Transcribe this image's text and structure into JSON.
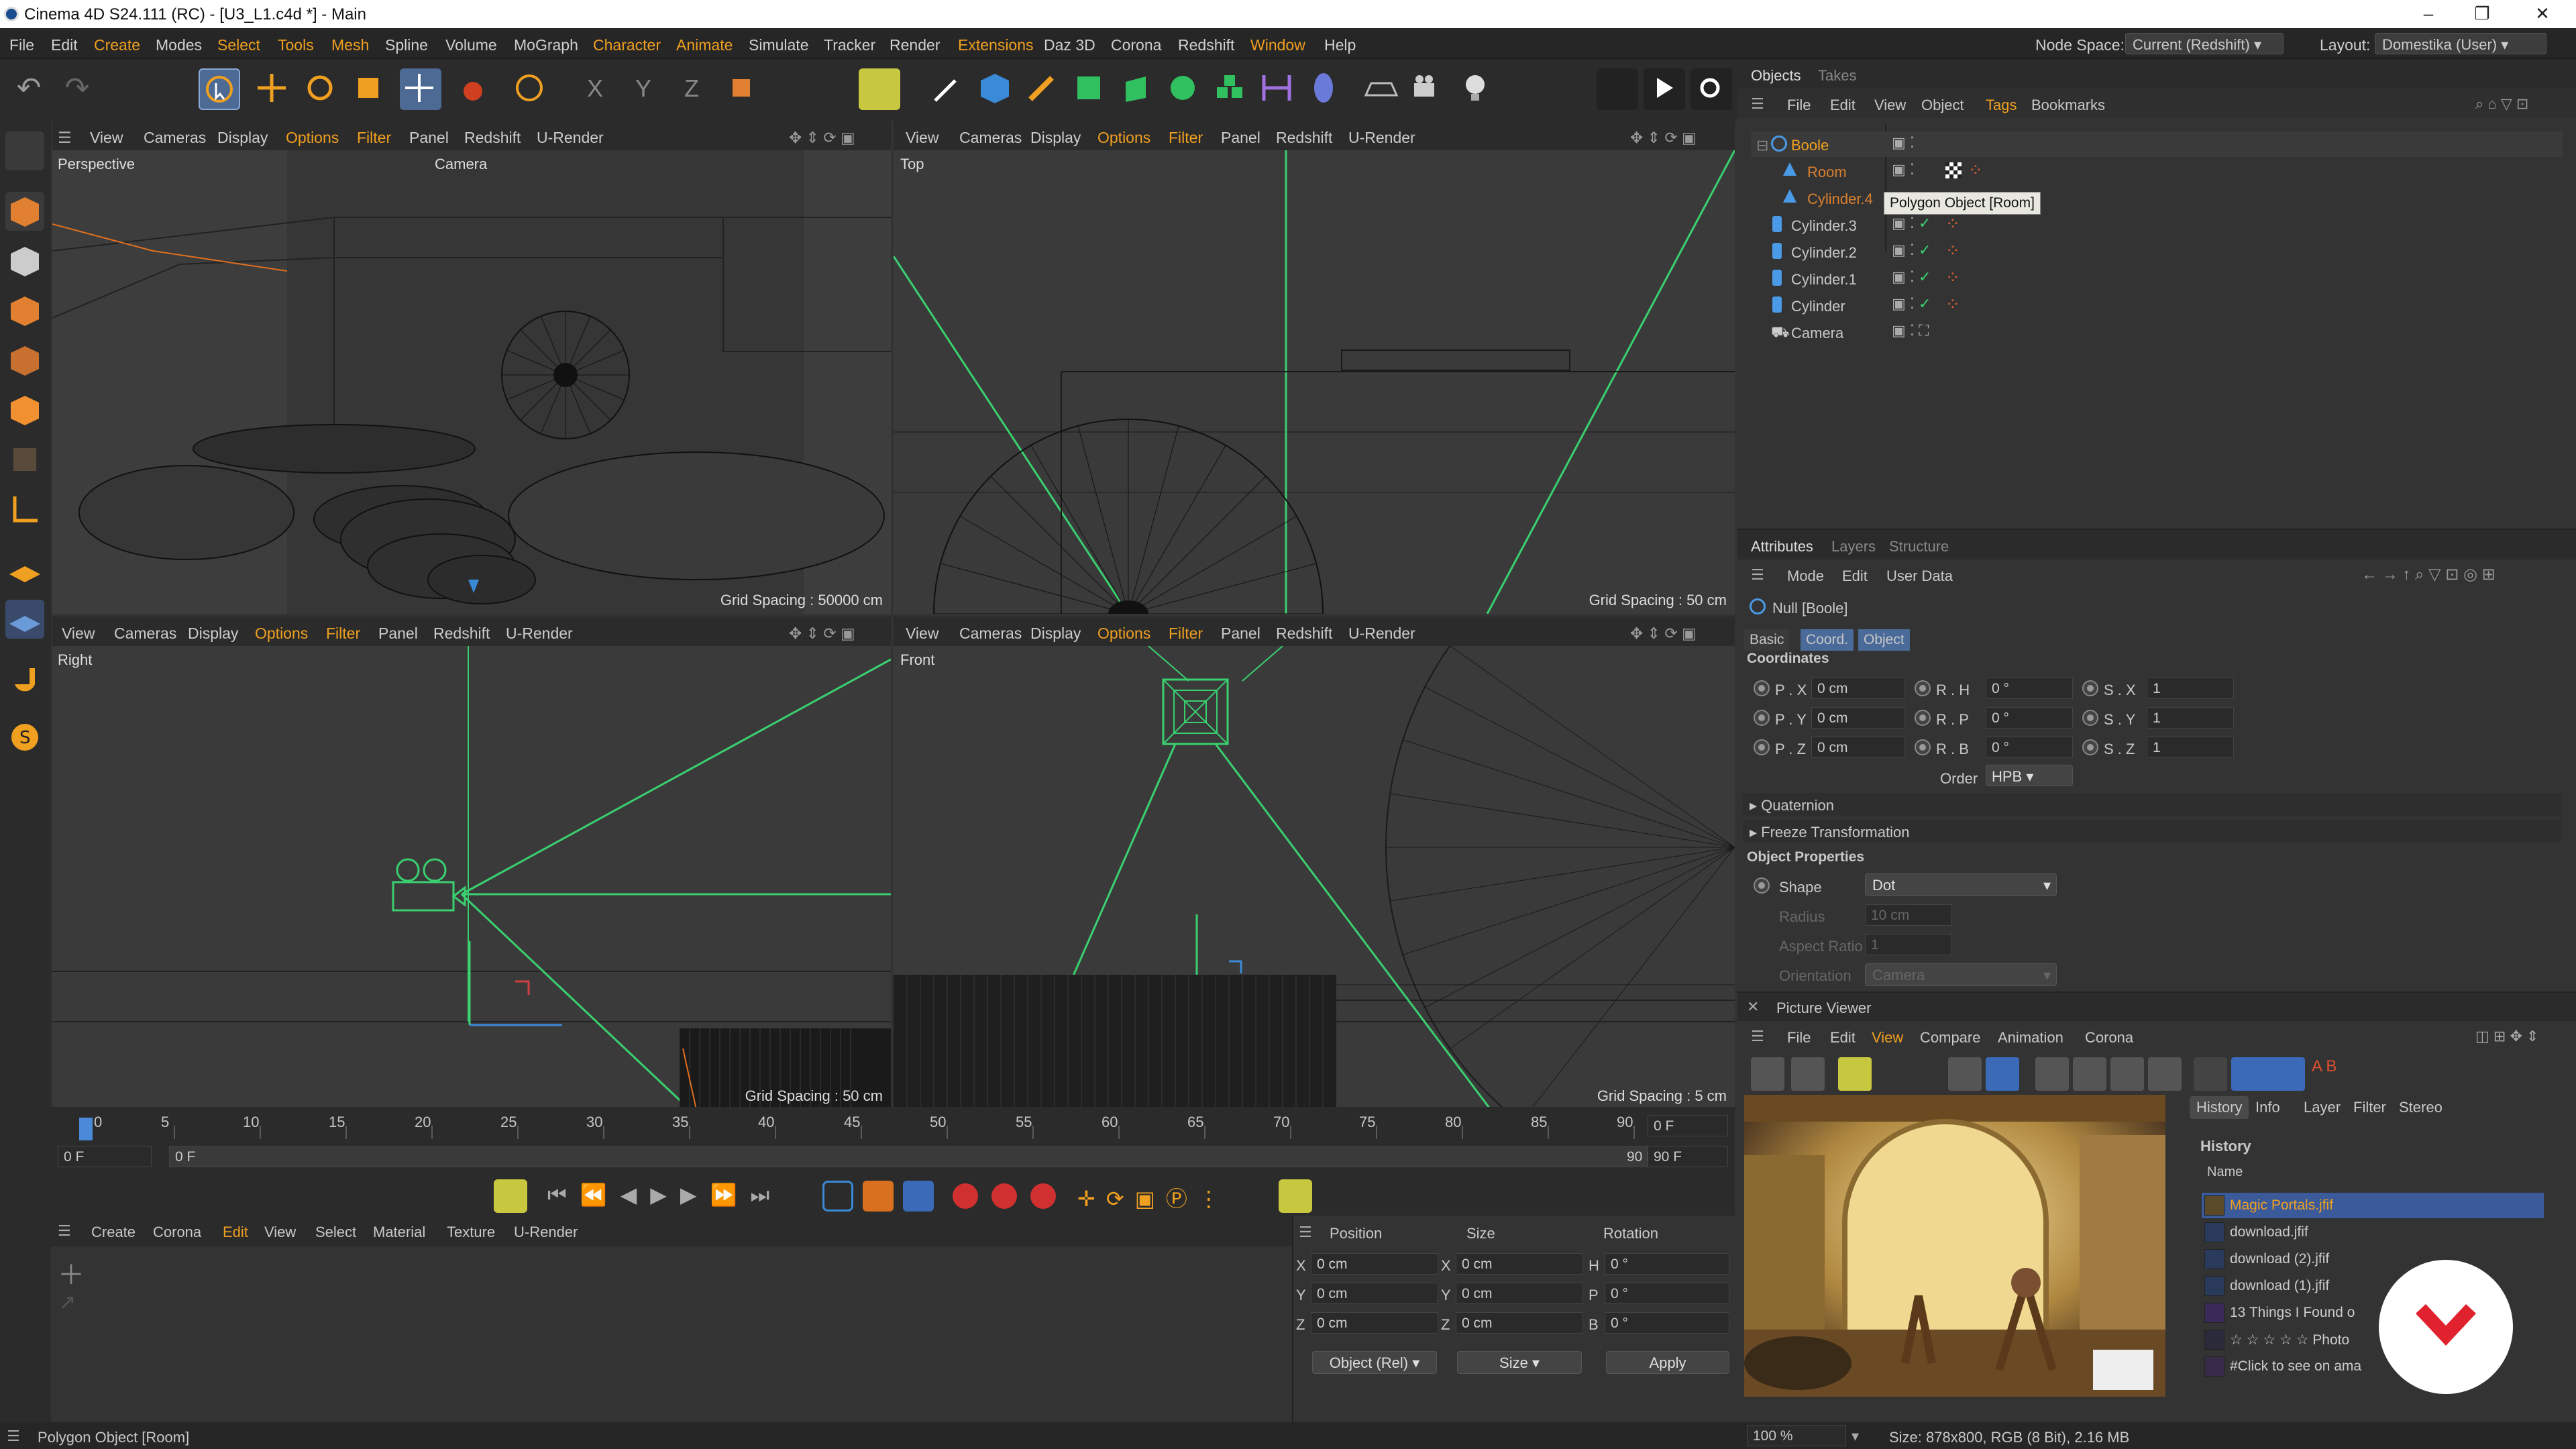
{
  "window": {
    "title": "Cinema 4D S24.111 (RC) - [U3_L1.c4d *] - Main",
    "min": "–",
    "max": "❐",
    "close": "✕"
  },
  "menu": {
    "items": [
      "File",
      "Edit",
      "Create",
      "Modes",
      "Select",
      "Tools",
      "Mesh",
      "Spline",
      "Volume",
      "MoGraph",
      "Character",
      "Animate",
      "Simulate",
      "Tracker",
      "Render",
      "Extensions",
      "Daz 3D",
      "Corona",
      "Redshift",
      "Window",
      "Help"
    ],
    "highlighted": [
      "Create",
      "Select",
      "Tools",
      "Mesh",
      "Character",
      "Animate",
      "Extensions",
      "Window"
    ],
    "node_space_label": "Node Space:",
    "node_space_value": "Current (Redshift)",
    "layout_label": "Layout:",
    "layout_value": "Domestika (User)"
  },
  "viewport_menu": [
    "View",
    "Cameras",
    "Display",
    "Options",
    "Filter",
    "Panel",
    "Redshift",
    "U-Render"
  ],
  "viewports": {
    "perspective": {
      "label": "Perspective",
      "camera": "Camera",
      "grid": "Grid Spacing : 50000 cm"
    },
    "top": {
      "label": "Top",
      "grid": "Grid Spacing : 50 cm"
    },
    "right": {
      "label": "Right",
      "grid": "Grid Spacing : 50 cm"
    },
    "front": {
      "label": "Front",
      "grid": "Grid Spacing : 5 cm"
    }
  },
  "timeline": {
    "ticks": [
      "0",
      "5",
      "10",
      "15",
      "20",
      "25",
      "30",
      "35",
      "40",
      "45",
      "50",
      "55",
      "60",
      "65",
      "70",
      "75",
      "80",
      "85",
      "90"
    ],
    "frame_current": "0 F",
    "start": "0 F",
    "start2": "0 F",
    "end": "90 F",
    "end2": "90 F"
  },
  "material_menu": [
    "Create",
    "Corona",
    "Edit",
    "View",
    "Select",
    "Material",
    "Texture",
    "U-Render"
  ],
  "coords": {
    "headers": [
      "Position",
      "Size",
      "Rotation"
    ],
    "rows": [
      {
        "axis": "X",
        "pos": "0 cm",
        "size_axis": "X",
        "size": "0 cm",
        "rot_axis": "H",
        "rot": "0 °"
      },
      {
        "axis": "Y",
        "pos": "0 cm",
        "size_axis": "Y",
        "size": "0 cm",
        "rot_axis": "P",
        "rot": "0 °"
      },
      {
        "axis": "Z",
        "pos": "0 cm",
        "size_axis": "Z",
        "size": "0 cm",
        "rot_axis": "B",
        "rot": "0 °"
      }
    ],
    "mode": "Object (Rel)",
    "size_mode": "Size",
    "apply": "Apply"
  },
  "status": "Polygon Object [Room]",
  "objects_panel": {
    "tabs": [
      "Objects",
      "Takes"
    ],
    "menu": [
      "File",
      "Edit",
      "View",
      "Object",
      "Tags",
      "Bookmarks"
    ],
    "tree": [
      {
        "name": "Boole",
        "color": "#f0a020"
      },
      {
        "name": "Room",
        "color": "#d88030"
      },
      {
        "name": "Cylinder.4",
        "color": "#d88030"
      },
      {
        "name": "Cylinder.3",
        "color": "#ccc"
      },
      {
        "name": "Cylinder.2",
        "color": "#ccc"
      },
      {
        "name": "Cylinder.1",
        "color": "#ccc"
      },
      {
        "name": "Cylinder",
        "color": "#ccc"
      },
      {
        "name": "Camera",
        "color": "#ccc"
      }
    ],
    "tooltip": "Polygon Object [Room]"
  },
  "attributes": {
    "tabs": [
      "Attributes",
      "Layers",
      "Structure"
    ],
    "menu": [
      "Mode",
      "Edit",
      "User Data"
    ],
    "object": "Null [Boole]",
    "subtabs": [
      "Basic",
      "Coord.",
      "Object"
    ],
    "section": "Coordinates",
    "rows": [
      {
        "p": "P . X",
        "pv": "0 cm",
        "r": "R . H",
        "rv": "0 °",
        "s": "S . X",
        "sv": "1"
      },
      {
        "p": "P . Y",
        "pv": "0 cm",
        "r": "R . P",
        "rv": "0 °",
        "s": "S . Y",
        "sv": "1"
      },
      {
        "p": "P . Z",
        "pv": "0 cm",
        "r": "R . B",
        "rv": "0 °",
        "s": "S . Z",
        "sv": "1"
      }
    ],
    "order_label": "Order",
    "order_value": "HPB",
    "quaternion": "Quaternion",
    "freeze": "Freeze Transformation",
    "obj_props": "Object Properties",
    "shape_label": "Shape",
    "shape_value": "Dot",
    "radius_label": "Radius",
    "radius_value": "10 cm",
    "aspect_label": "Aspect Ratio",
    "aspect_value": "1",
    "orient_label": "Orientation",
    "orient_value": "Camera"
  },
  "picture_viewer": {
    "title": "Picture Viewer",
    "menu": [
      "File",
      "Edit",
      "View",
      "Compare",
      "Animation",
      "Corona"
    ],
    "side_tabs": [
      "History",
      "Info",
      "Layer",
      "Filter",
      "Stereo"
    ],
    "history_title": "History",
    "name_col": "Name",
    "history": [
      "Magic Portals.jfif",
      "download.jfif",
      "download (2).jfif",
      "download (1).jfif",
      "13 Things I Found o",
      "☆ ☆ ☆ ☆ ☆  Photo",
      "#Click to see on ama"
    ],
    "zoom": "100 %",
    "size_info": "Size: 878x800, RGB (8 Bit), 2.16 MB"
  }
}
